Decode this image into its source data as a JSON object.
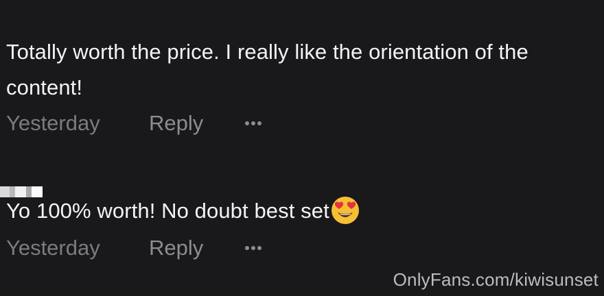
{
  "comments": [
    {
      "text": "Totally worth the price. I really like the orientation of the content!",
      "time": "Yesterday",
      "reply_label": "Reply"
    },
    {
      "text": "Yo 100% worth! No doubt best set",
      "emoji": "heart-eyes-emoji",
      "time": "Yesterday",
      "reply_label": "Reply"
    }
  ],
  "watermark": "OnlyFans.com/kiwisunset",
  "colors": {
    "background": "#19181b",
    "text": "#f4f4f4",
    "meta": "#7b7b80"
  }
}
